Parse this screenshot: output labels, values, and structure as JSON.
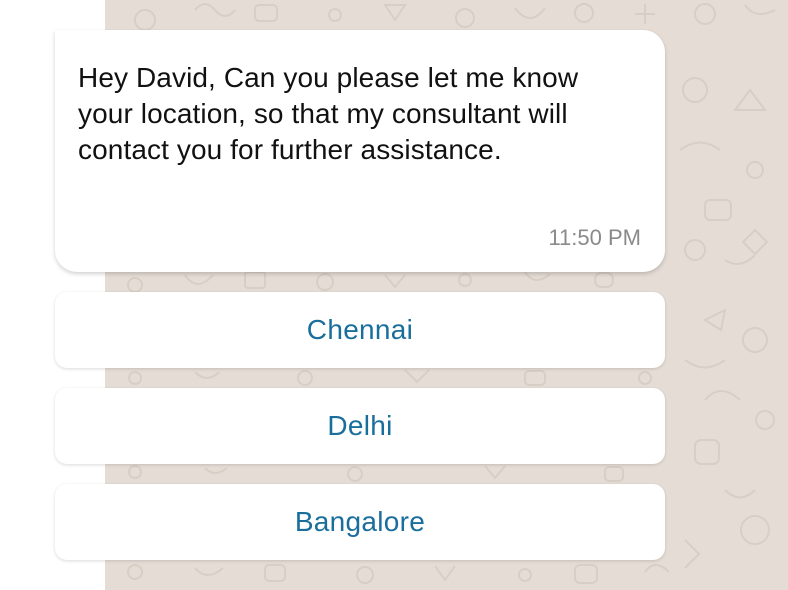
{
  "message": {
    "text": "Hey David, Can you please let me know your location, so that my consultant will contact you for further assistance.",
    "time": "11:50 PM"
  },
  "quick_replies": [
    {
      "label": "Chennai"
    },
    {
      "label": "Delhi"
    },
    {
      "label": "Bangalore"
    }
  ],
  "colors": {
    "chat_background": "#e5ddd5",
    "bubble": "#ffffff",
    "reply_text": "#1a6e9c",
    "timestamp": "#8a8a8a"
  }
}
